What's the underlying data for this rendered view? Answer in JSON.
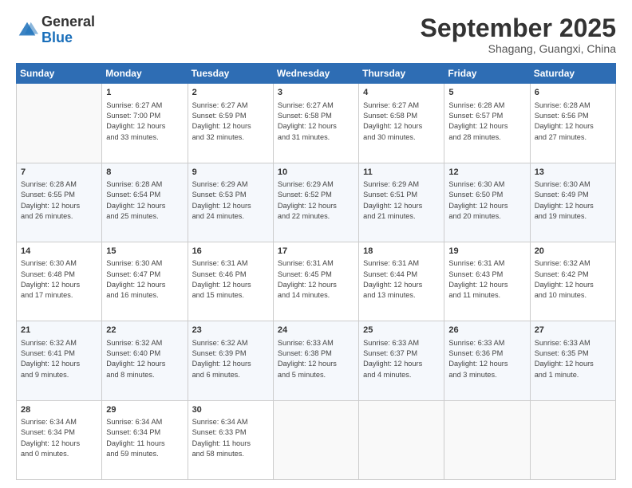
{
  "header": {
    "logo_general": "General",
    "logo_blue": "Blue",
    "month_title": "September 2025",
    "location": "Shagang, Guangxi, China"
  },
  "columns": [
    "Sunday",
    "Monday",
    "Tuesday",
    "Wednesday",
    "Thursday",
    "Friday",
    "Saturday"
  ],
  "weeks": [
    [
      {
        "day": "",
        "info": ""
      },
      {
        "day": "1",
        "info": "Sunrise: 6:27 AM\nSunset: 7:00 PM\nDaylight: 12 hours\nand 33 minutes."
      },
      {
        "day": "2",
        "info": "Sunrise: 6:27 AM\nSunset: 6:59 PM\nDaylight: 12 hours\nand 32 minutes."
      },
      {
        "day": "3",
        "info": "Sunrise: 6:27 AM\nSunset: 6:58 PM\nDaylight: 12 hours\nand 31 minutes."
      },
      {
        "day": "4",
        "info": "Sunrise: 6:27 AM\nSunset: 6:58 PM\nDaylight: 12 hours\nand 30 minutes."
      },
      {
        "day": "5",
        "info": "Sunrise: 6:28 AM\nSunset: 6:57 PM\nDaylight: 12 hours\nand 28 minutes."
      },
      {
        "day": "6",
        "info": "Sunrise: 6:28 AM\nSunset: 6:56 PM\nDaylight: 12 hours\nand 27 minutes."
      }
    ],
    [
      {
        "day": "7",
        "info": "Sunrise: 6:28 AM\nSunset: 6:55 PM\nDaylight: 12 hours\nand 26 minutes."
      },
      {
        "day": "8",
        "info": "Sunrise: 6:28 AM\nSunset: 6:54 PM\nDaylight: 12 hours\nand 25 minutes."
      },
      {
        "day": "9",
        "info": "Sunrise: 6:29 AM\nSunset: 6:53 PM\nDaylight: 12 hours\nand 24 minutes."
      },
      {
        "day": "10",
        "info": "Sunrise: 6:29 AM\nSunset: 6:52 PM\nDaylight: 12 hours\nand 22 minutes."
      },
      {
        "day": "11",
        "info": "Sunrise: 6:29 AM\nSunset: 6:51 PM\nDaylight: 12 hours\nand 21 minutes."
      },
      {
        "day": "12",
        "info": "Sunrise: 6:30 AM\nSunset: 6:50 PM\nDaylight: 12 hours\nand 20 minutes."
      },
      {
        "day": "13",
        "info": "Sunrise: 6:30 AM\nSunset: 6:49 PM\nDaylight: 12 hours\nand 19 minutes."
      }
    ],
    [
      {
        "day": "14",
        "info": "Sunrise: 6:30 AM\nSunset: 6:48 PM\nDaylight: 12 hours\nand 17 minutes."
      },
      {
        "day": "15",
        "info": "Sunrise: 6:30 AM\nSunset: 6:47 PM\nDaylight: 12 hours\nand 16 minutes."
      },
      {
        "day": "16",
        "info": "Sunrise: 6:31 AM\nSunset: 6:46 PM\nDaylight: 12 hours\nand 15 minutes."
      },
      {
        "day": "17",
        "info": "Sunrise: 6:31 AM\nSunset: 6:45 PM\nDaylight: 12 hours\nand 14 minutes."
      },
      {
        "day": "18",
        "info": "Sunrise: 6:31 AM\nSunset: 6:44 PM\nDaylight: 12 hours\nand 13 minutes."
      },
      {
        "day": "19",
        "info": "Sunrise: 6:31 AM\nSunset: 6:43 PM\nDaylight: 12 hours\nand 11 minutes."
      },
      {
        "day": "20",
        "info": "Sunrise: 6:32 AM\nSunset: 6:42 PM\nDaylight: 12 hours\nand 10 minutes."
      }
    ],
    [
      {
        "day": "21",
        "info": "Sunrise: 6:32 AM\nSunset: 6:41 PM\nDaylight: 12 hours\nand 9 minutes."
      },
      {
        "day": "22",
        "info": "Sunrise: 6:32 AM\nSunset: 6:40 PM\nDaylight: 12 hours\nand 8 minutes."
      },
      {
        "day": "23",
        "info": "Sunrise: 6:32 AM\nSunset: 6:39 PM\nDaylight: 12 hours\nand 6 minutes."
      },
      {
        "day": "24",
        "info": "Sunrise: 6:33 AM\nSunset: 6:38 PM\nDaylight: 12 hours\nand 5 minutes."
      },
      {
        "day": "25",
        "info": "Sunrise: 6:33 AM\nSunset: 6:37 PM\nDaylight: 12 hours\nand 4 minutes."
      },
      {
        "day": "26",
        "info": "Sunrise: 6:33 AM\nSunset: 6:36 PM\nDaylight: 12 hours\nand 3 minutes."
      },
      {
        "day": "27",
        "info": "Sunrise: 6:33 AM\nSunset: 6:35 PM\nDaylight: 12 hours\nand 1 minute."
      }
    ],
    [
      {
        "day": "28",
        "info": "Sunrise: 6:34 AM\nSunset: 6:34 PM\nDaylight: 12 hours\nand 0 minutes."
      },
      {
        "day": "29",
        "info": "Sunrise: 6:34 AM\nSunset: 6:34 PM\nDaylight: 11 hours\nand 59 minutes."
      },
      {
        "day": "30",
        "info": "Sunrise: 6:34 AM\nSunset: 6:33 PM\nDaylight: 11 hours\nand 58 minutes."
      },
      {
        "day": "",
        "info": ""
      },
      {
        "day": "",
        "info": ""
      },
      {
        "day": "",
        "info": ""
      },
      {
        "day": "",
        "info": ""
      }
    ]
  ]
}
